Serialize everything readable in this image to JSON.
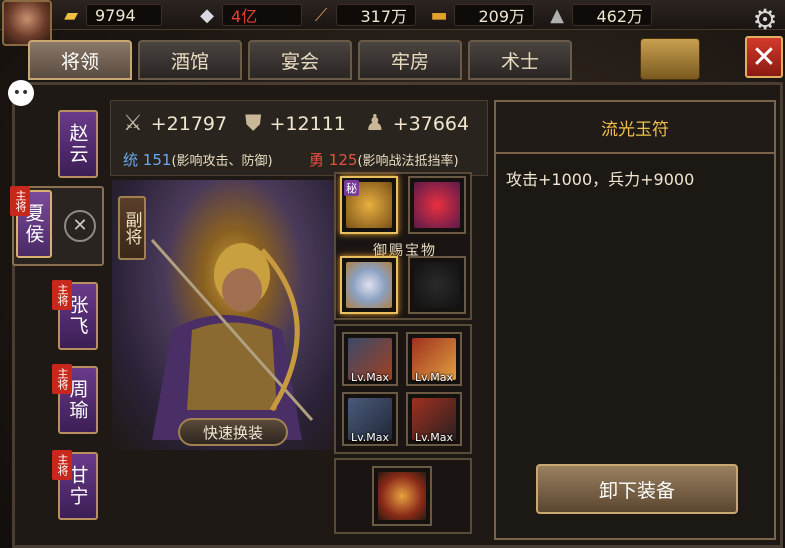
{
  "resources": [
    {
      "icon": "gold-ingot-icon",
      "value": "9794"
    },
    {
      "icon": "silver-icon",
      "value": "4亿"
    },
    {
      "icon": "wood-icon",
      "value": "317万"
    },
    {
      "icon": "copper-icon",
      "value": "209万"
    },
    {
      "icon": "stone-icon",
      "value": "462万"
    }
  ],
  "tabs": [
    {
      "label": "将领",
      "active": true
    },
    {
      "label": "酒馆"
    },
    {
      "label": "宴会"
    },
    {
      "label": "牢房"
    },
    {
      "label": "术士"
    }
  ],
  "generals": [
    {
      "name": "赵云",
      "badge": ""
    },
    {
      "name": "夏侯",
      "badge": "主将"
    },
    {
      "name": "张飞",
      "badge": "主将"
    },
    {
      "name": "周瑜",
      "badge": "主将"
    },
    {
      "name": "甘宁",
      "badge": "主将"
    }
  ],
  "stats": {
    "attack": "+21797",
    "defense": "+12111",
    "troops": "+37664",
    "tong_label": "统",
    "tong_value": "151",
    "tong_desc": "(影响攻击、防御)",
    "yong_label": "勇",
    "yong_value": "125",
    "yong_desc": "(影响战法抵挡率)"
  },
  "portrait": {
    "deputy_label": "副将",
    "quick_equip": "快速换装"
  },
  "equipment": {
    "secret_badge": "秘",
    "bonus_title": "御赐宝物",
    "lv_max": "Lv.Max"
  },
  "detail": {
    "title": "流光玉符",
    "description": "攻击+1000，兵力+9000",
    "unequip_label": "卸下装备"
  },
  "colors": {
    "gold": "#f0c050",
    "purple": "#6a3a8a",
    "red_badge": "#c8281c",
    "tong_blue": "#6aa8e8",
    "yong_red": "#e85040"
  }
}
